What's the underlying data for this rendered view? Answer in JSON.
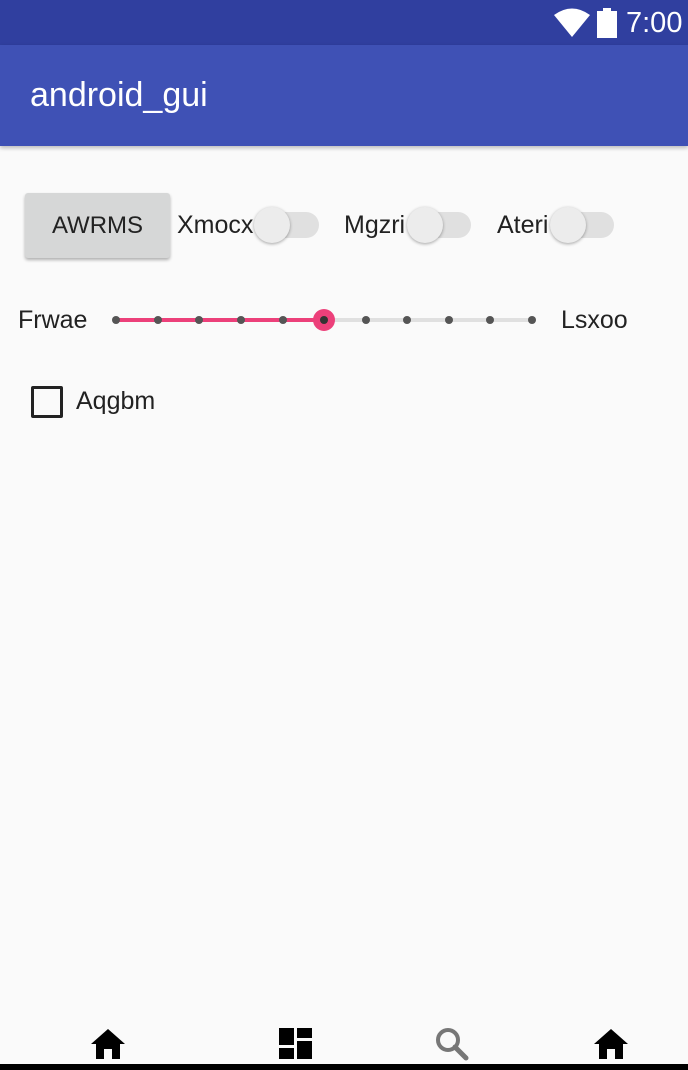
{
  "status_bar": {
    "time": "7:00",
    "icons": [
      "wifi-icon",
      "battery-icon"
    ],
    "background": "#303f9f"
  },
  "app_bar": {
    "title": "android_gui",
    "background": "#3f51b5"
  },
  "controls": {
    "button": {
      "label": "AWRMS"
    },
    "switches": [
      {
        "label": "Xmocx",
        "checked": false
      },
      {
        "label": "Mgzri",
        "checked": false
      },
      {
        "label": "Ateri",
        "checked": false
      }
    ],
    "slider": {
      "left_label": "Frwae",
      "right_label": "Lsxoo",
      "steps": 10,
      "value": 5,
      "accent": "#ec407a"
    },
    "checkbox": {
      "label": "Aqgbm",
      "checked": false
    }
  },
  "bottom_nav": {
    "items": [
      {
        "icon": "home-icon"
      },
      {
        "icon": "dashboard-icon"
      },
      {
        "icon": "search-icon"
      },
      {
        "icon": "home-icon"
      }
    ]
  }
}
